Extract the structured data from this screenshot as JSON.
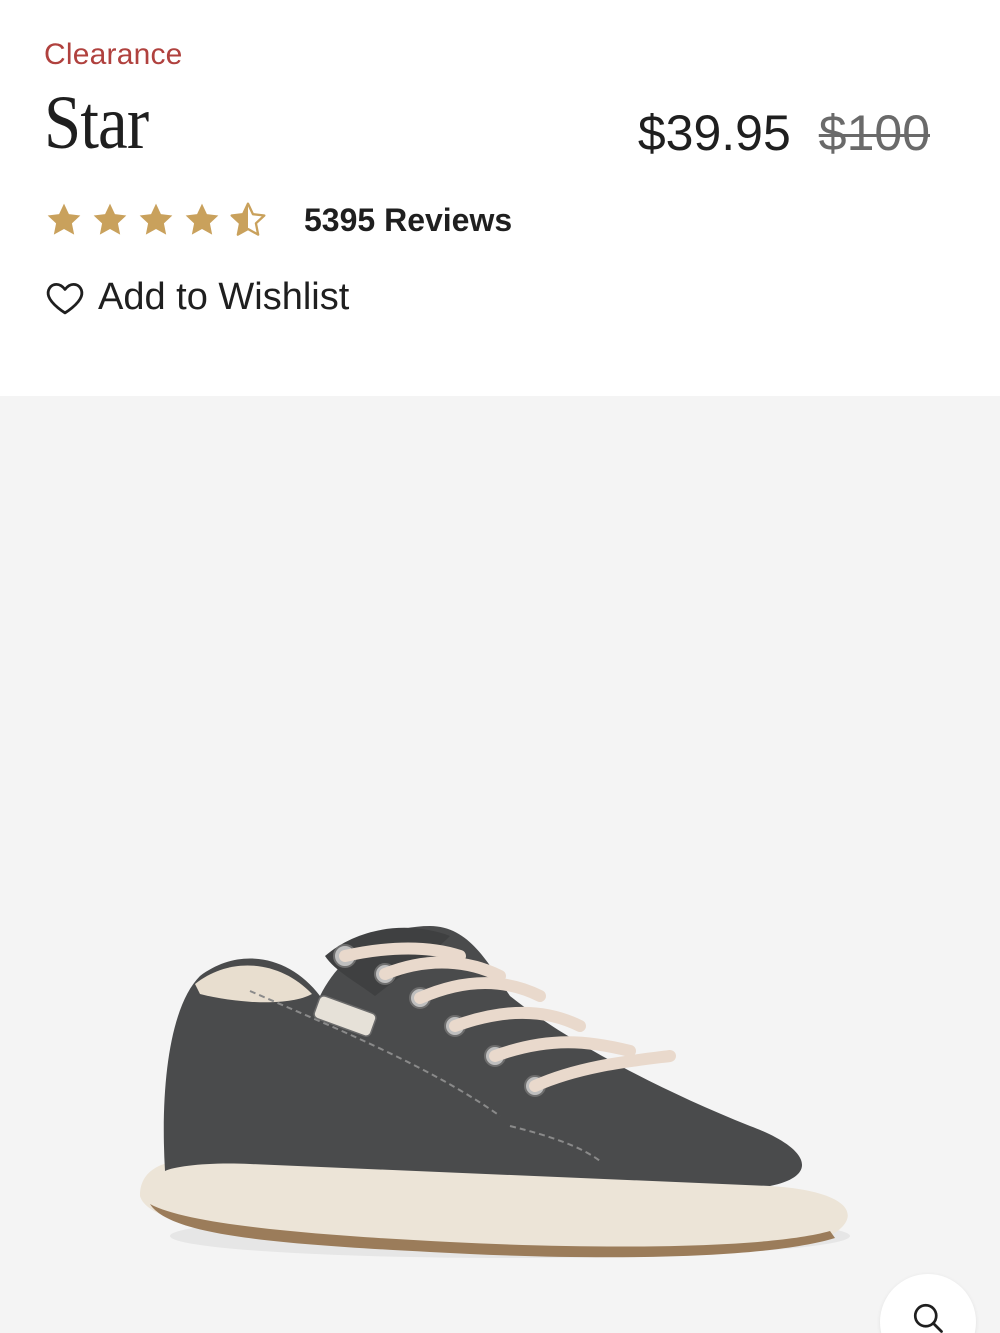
{
  "product": {
    "badge": "Clearance",
    "name": "Star",
    "price_sale": "$39.95",
    "price_original": "$100",
    "rating_value": 4.5,
    "rating_max": 5,
    "reviews_label": "5395 Reviews",
    "wishlist_label": "Add to Wishlist"
  },
  "colors": {
    "badge": "#b0413e",
    "star": "#c9a15c",
    "gallery_bg": "#f4f4f4"
  },
  "icons": {
    "wishlist": "heart-outline-icon",
    "zoom": "search-icon",
    "rating": "star-icon"
  }
}
